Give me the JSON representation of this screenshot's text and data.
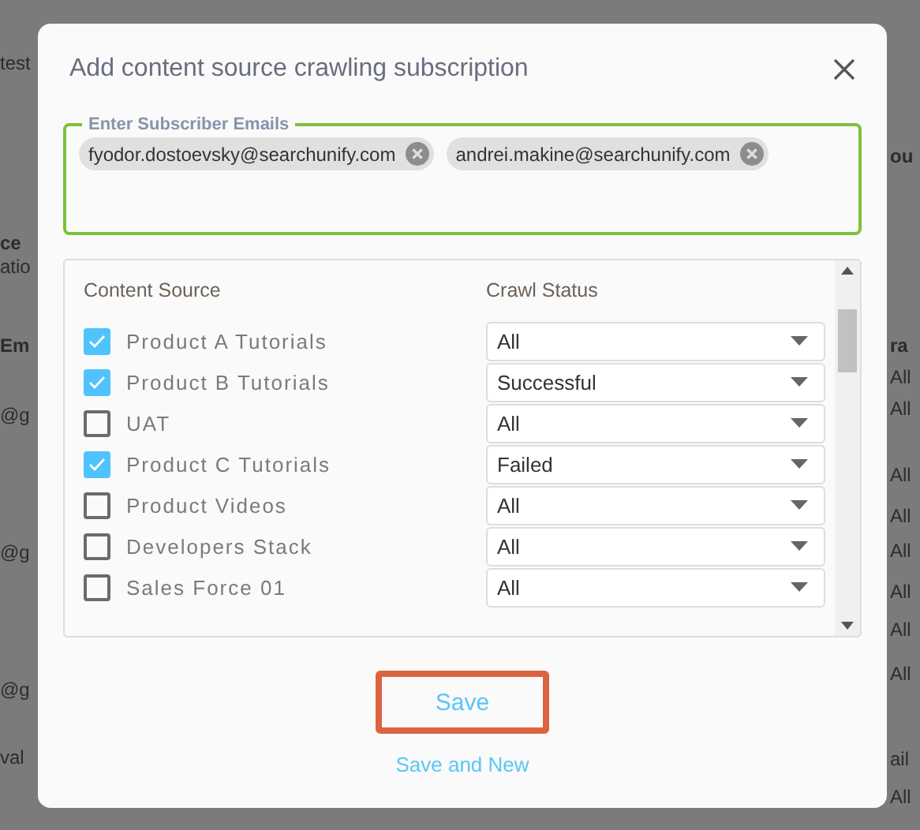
{
  "background": {
    "left": [
      {
        "text": "test",
        "bold": false
      },
      {
        "text": "ce",
        "bold": true
      },
      {
        "text": "atio",
        "bold": false
      },
      {
        "text": "Em",
        "bold": true
      },
      {
        "text": "@g",
        "bold": false
      },
      {
        "text": "@g",
        "bold": false
      },
      {
        "text": "@g",
        "bold": false
      },
      {
        "text": "val",
        "bold": false
      }
    ],
    "right": [
      {
        "text": "ou",
        "bold": true
      },
      {
        "text": "ra",
        "bold": true
      },
      {
        "text": "All",
        "bold": false
      },
      {
        "text": "All",
        "bold": false
      },
      {
        "text": "All",
        "bold": false
      },
      {
        "text": "All",
        "bold": false
      },
      {
        "text": "All",
        "bold": false
      },
      {
        "text": "All",
        "bold": false
      },
      {
        "text": "All",
        "bold": false
      },
      {
        "text": "All",
        "bold": false
      },
      {
        "text": "ail",
        "bold": false
      },
      {
        "text": "All",
        "bold": false
      }
    ]
  },
  "dialog": {
    "title": "Add content source crawling subscription",
    "emails": {
      "label": "Enter Subscriber Emails",
      "chips": [
        "fyodor.dostoevsky@searchunify.com",
        "andrei.makine@searchunify.com"
      ]
    },
    "table": {
      "columns": [
        "Content Source",
        "Crawl Status"
      ],
      "rows": [
        {
          "name": "Product A Tutorials",
          "checked": true,
          "status": "All"
        },
        {
          "name": "Product B Tutorials",
          "checked": true,
          "status": "Successful"
        },
        {
          "name": "UAT",
          "checked": false,
          "status": "All"
        },
        {
          "name": "Product C Tutorials",
          "checked": true,
          "status": "Failed"
        },
        {
          "name": "Product Videos",
          "checked": false,
          "status": "All"
        },
        {
          "name": "Developers Stack",
          "checked": false,
          "status": "All"
        },
        {
          "name": "Sales Force 01",
          "checked": false,
          "status": "All"
        }
      ]
    },
    "buttons": {
      "save": "Save",
      "save_and_new": "Save and New"
    }
  }
}
